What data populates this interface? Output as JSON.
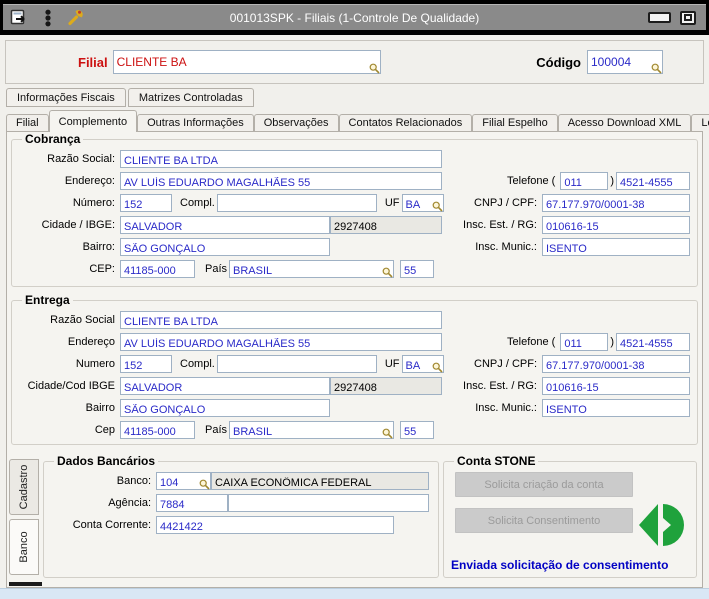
{
  "titlebar": {
    "title": "001013SPK - Filiais (1-Controle De Qualidade)"
  },
  "header": {
    "filial_label": "Filial",
    "filial_value": "CLIENTE BA",
    "codigo_label": "Código",
    "codigo_value": "100004"
  },
  "tabs_top": {
    "items": [
      {
        "label": "Informações Fiscais"
      },
      {
        "label": "Matrizes Controladas"
      }
    ]
  },
  "tabs_main": {
    "active": "Complemento",
    "items": [
      {
        "label": "Filial"
      },
      {
        "label": "Complemento"
      },
      {
        "label": "Outras Informações"
      },
      {
        "label": "Observações"
      },
      {
        "label": "Contatos Relacionados"
      },
      {
        "label": "Filial Espelho"
      },
      {
        "label": "Acesso Download XML"
      },
      {
        "label": "Log"
      }
    ]
  },
  "cobranca": {
    "title": "Cobrança",
    "razao_label": "Razão Social:",
    "razao": "CLIENTE BA LTDA",
    "endereco_label": "Endereço:",
    "endereco": "AV LUÍS EDUARDO MAGALHÃES 55",
    "numero_label": "Número:",
    "numero": "152",
    "compl_label": "Compl.",
    "compl": "",
    "uf_label": "UF",
    "uf": "BA",
    "cidade_label": "Cidade / IBGE:",
    "cidade": "SALVADOR",
    "ibge": "2927408",
    "bairro_label": "Bairro:",
    "bairro": "SÃO GONÇALO",
    "cep_label": "CEP:",
    "cep": "41185-000",
    "pais_label": "País",
    "pais": "BRASIL",
    "pais_cod": "55",
    "telefone_label": "Telefone (",
    "telefone_close": ")",
    "ddd": "011",
    "telefone": "4521-4555",
    "cnpj_label": "CNPJ / CPF:",
    "cnpj": "67.177.970/0001-38",
    "insc_est_label": "Insc. Est. / RG:",
    "insc_est": "010616-15",
    "insc_mun_label": "Insc. Munic.:",
    "insc_mun": "ISENTO"
  },
  "entrega": {
    "title": "Entrega",
    "razao_label": "Razão Social",
    "razao": "CLIENTE BA LTDA",
    "endereco_label": "Endereço",
    "endereco": "AV LUÍS EDUARDO MAGALHÃES 55",
    "numero_label": "Numero",
    "numero": "152",
    "compl_label": "Compl.",
    "compl": "",
    "uf_label": "UF",
    "uf": "BA",
    "cidade_label": "Cidade/Cod IBGE",
    "cidade": "SALVADOR",
    "ibge": "2927408",
    "bairro_label": "Bairro",
    "bairro": "SÃO GONÇALO",
    "cep_label": "Cep",
    "cep": "41185-000",
    "pais_label": "País",
    "pais": "BRASIL",
    "pais_cod": "55",
    "telefone_label": "Telefone (",
    "telefone_close": ")",
    "ddd": "011",
    "telefone": "4521-4555",
    "cnpj_label": "CNPJ / CPF:",
    "cnpj": "67.177.970/0001-38",
    "insc_est_label": "Insc. Est. / RG:",
    "insc_est": "010616-15",
    "insc_mun_label": "Insc. Munic.:",
    "insc_mun": "ISENTO"
  },
  "side_tabs": {
    "cadastro": "Cadastro",
    "banco": "Banco",
    "active": "Banco"
  },
  "dados_bancarios": {
    "title": "Dados Bancários",
    "banco_label": "Banco:",
    "banco_cod": "104",
    "banco_nome": "CAIXA ECONÔMICA FEDERAL",
    "agencia_label": "Agência:",
    "agencia": "7884",
    "agencia_compl": "",
    "conta_label": "Conta Corrente:",
    "conta": "4421422"
  },
  "conta_stone": {
    "title": "Conta STONE",
    "solicita_criacao": "Solicita criação da conta",
    "solicita_consentimento": "Solicita Consentimento",
    "status": "Enviada solicitação de consentimento"
  },
  "colors": {
    "value_blue": "#2a2ac8",
    "alert_red": "#cc1111",
    "stone_green": "#1fa23c",
    "status_blue": "#0101c4",
    "titlebar_grey": "#8a8a8a",
    "disabled_field": "#e9e8e3"
  },
  "icons": {
    "titlebar": [
      "exit-window-icon",
      "traffic-light-icon",
      "wrench-icon"
    ],
    "window_controls": [
      "minimize-icon",
      "restore-icon"
    ],
    "field_lookup": "magnifier-icon",
    "stone": "stone-logo-icon"
  }
}
